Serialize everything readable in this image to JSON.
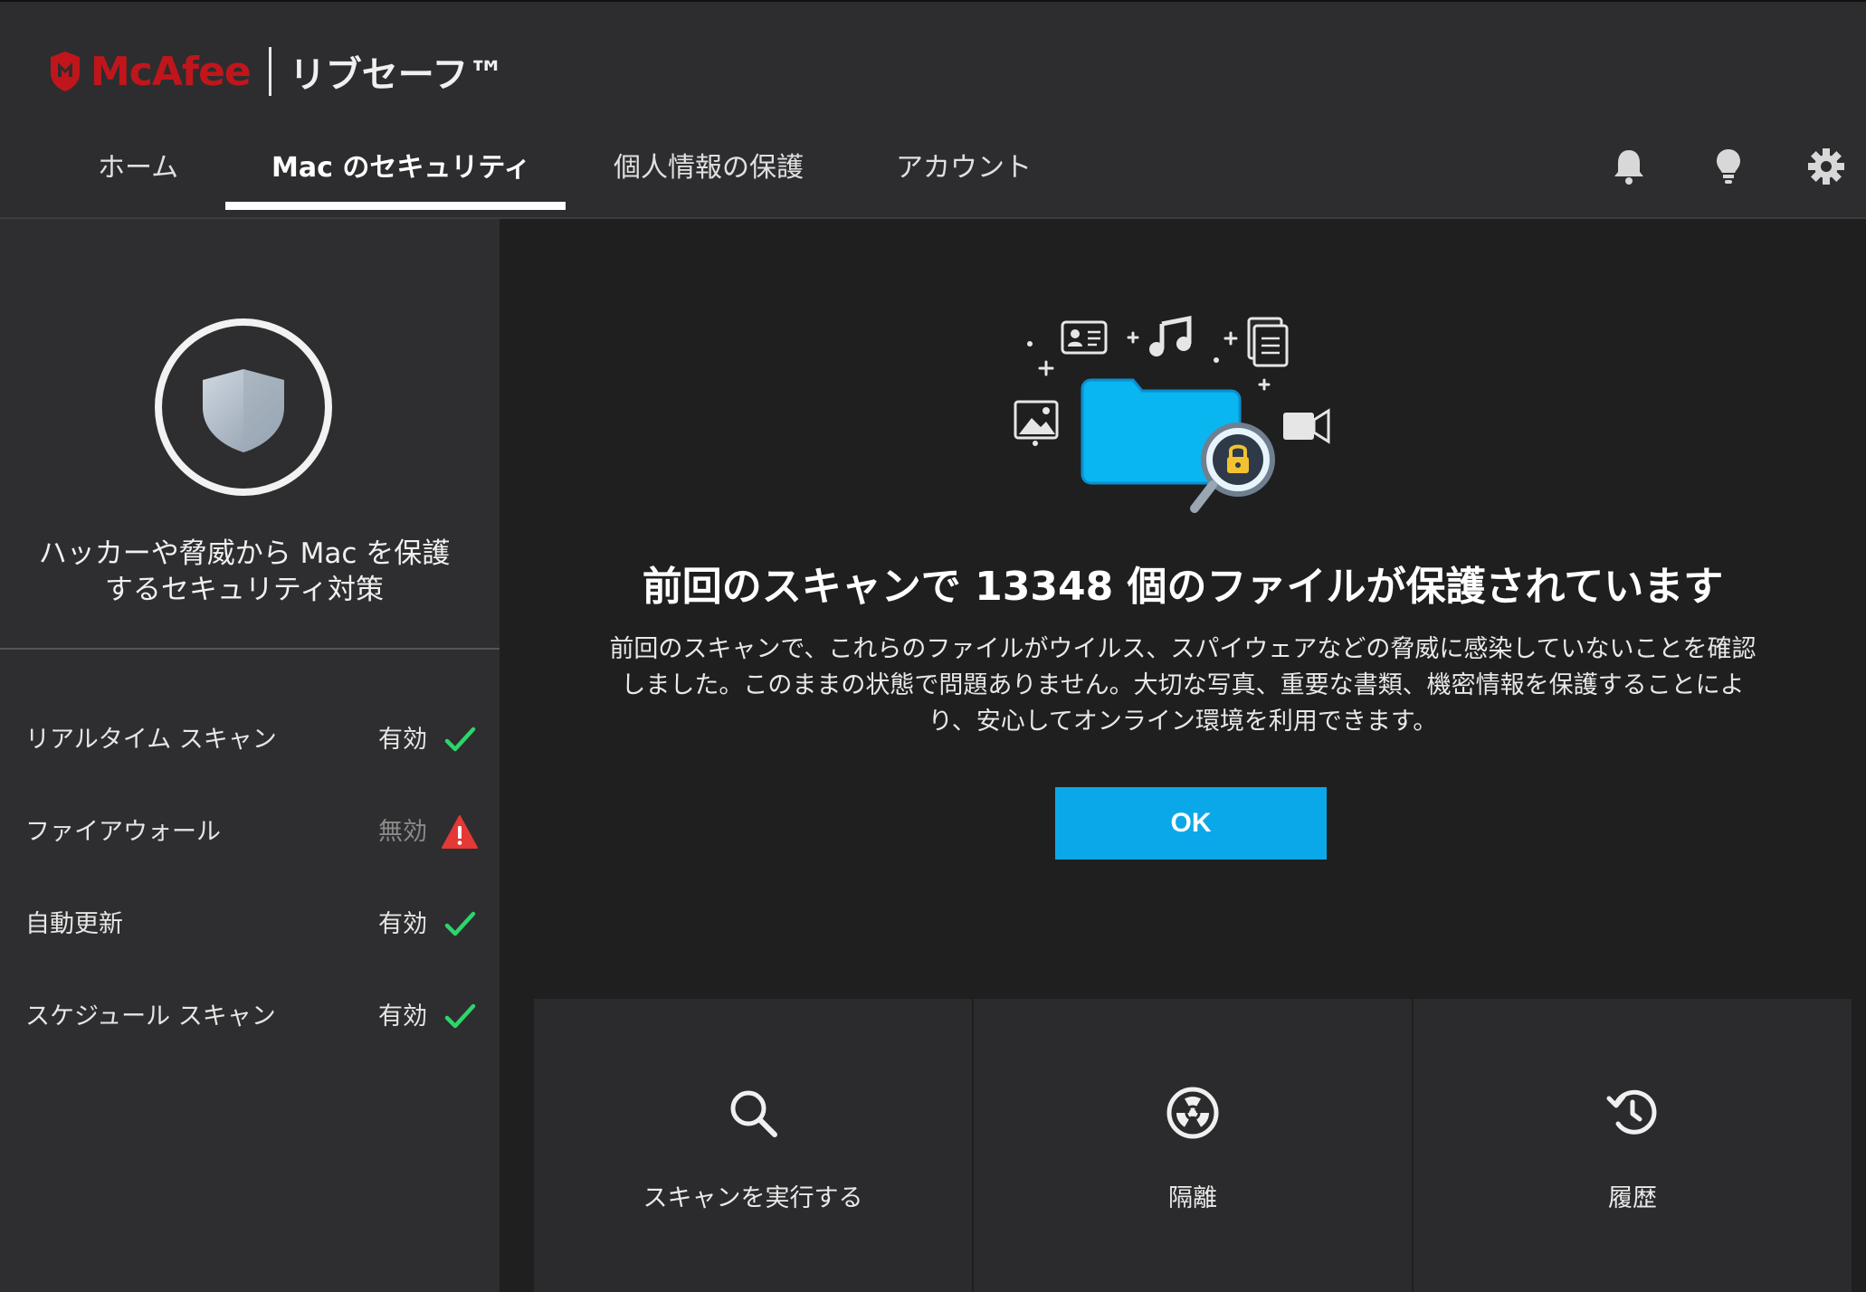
{
  "app": {
    "brand": "McAfee",
    "product": "リブセーフ™"
  },
  "nav": {
    "tabs": [
      {
        "label": "ホーム"
      },
      {
        "label": "Mac のセキュリティ",
        "active": true
      },
      {
        "label": "個人情報の保護"
      },
      {
        "label": "アカウント"
      }
    ],
    "icons": [
      "bell-icon",
      "lightbulb-icon",
      "gear-icon"
    ]
  },
  "sidebar": {
    "title": "ハッカーや脅威から Mac を保護するセキュリティ対策",
    "statuses": [
      {
        "label": "リアルタイム スキャン",
        "value": "有効",
        "state": "ok"
      },
      {
        "label": "ファイアウォール",
        "value": "無効",
        "state": "warning"
      },
      {
        "label": "自動更新",
        "value": "有効",
        "state": "ok"
      },
      {
        "label": "スケジュール スキャン",
        "value": "有効",
        "state": "ok"
      }
    ]
  },
  "main": {
    "headline": "前回のスキャンで 13348 個のファイルが保護されています",
    "description": "前回のスキャンで、これらのファイルがウイルス、スパイウェアなどの脅威に感染していないことを確認しました。このままの状態で問題ありません。大切な写真、重要な書類、機密情報を保護することにより、安心してオンライン環境を利用できます。",
    "ok_label": "OK",
    "cards": [
      {
        "label": "スキャンを実行する",
        "icon": "search-icon"
      },
      {
        "label": "隔離",
        "icon": "radiation-icon"
      },
      {
        "label": "履歴",
        "icon": "history-icon"
      }
    ]
  },
  "colors": {
    "accent": "#0aa8e8",
    "brand_red": "#c0161b",
    "ok_green": "#2bd66b",
    "warning_red": "#e53935"
  }
}
